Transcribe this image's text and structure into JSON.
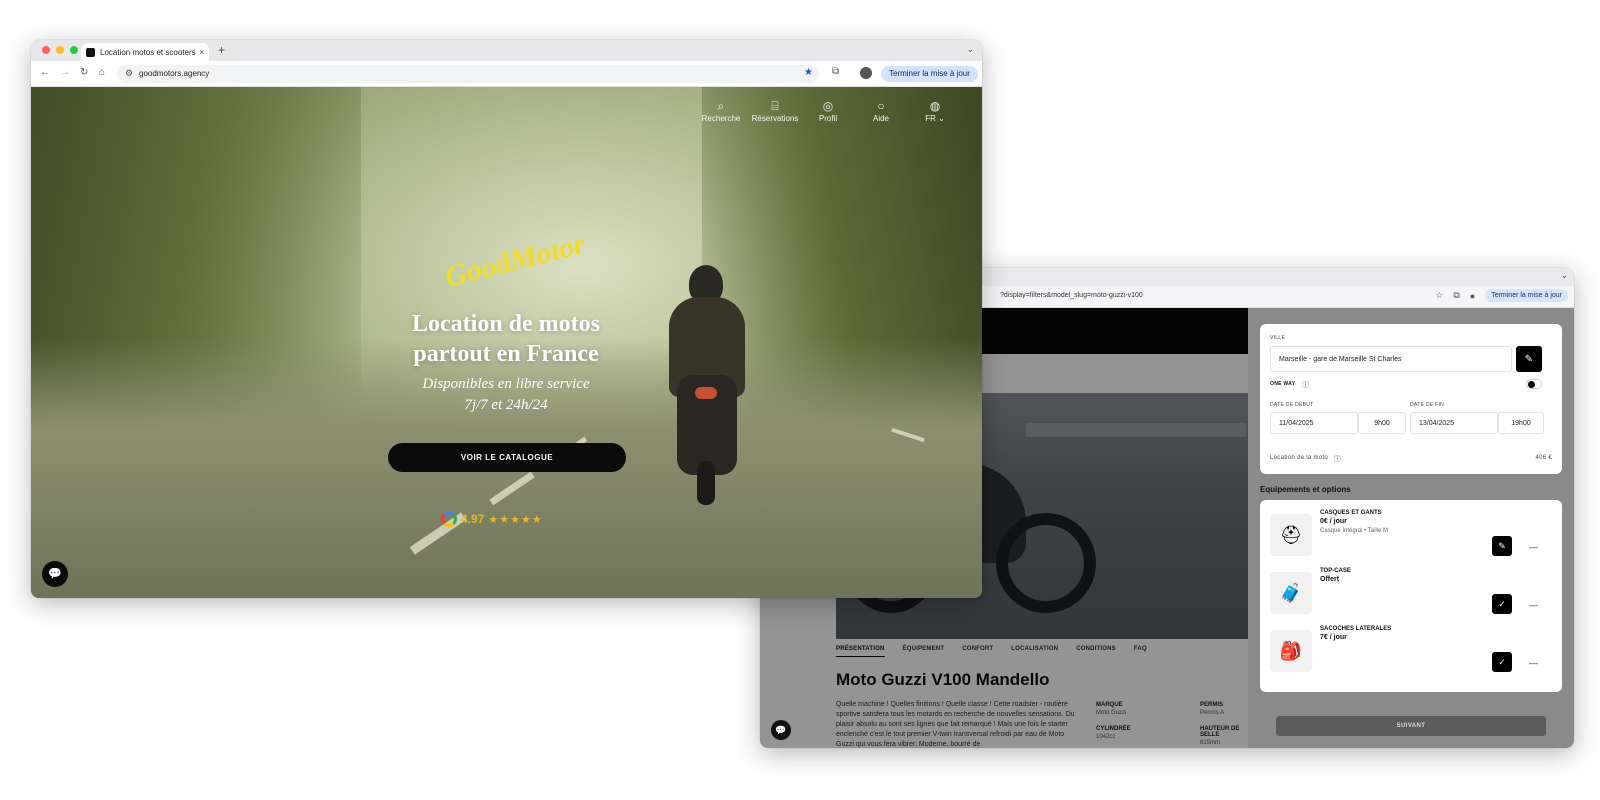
{
  "front": {
    "tab_title": "Location motos et scooters",
    "tab_close": "×",
    "new_tab": "+",
    "url": "goodmotors.agency",
    "update_btn": "Terminer la mise à jour",
    "nav": [
      {
        "label": "Recherche",
        "icon": "search-icon"
      },
      {
        "label": "Réservations",
        "icon": "bike-icon"
      },
      {
        "label": "Profil",
        "icon": "user-icon"
      },
      {
        "label": "Aide",
        "icon": "help-icon"
      },
      {
        "label": "FR",
        "icon": "globe-icon"
      }
    ],
    "logo_text": "GoodMotors",
    "hero_title_line1": "Location de motos",
    "hero_title_line2": "partout en France",
    "hero_sub_line1": "Disponibles en libre service",
    "hero_sub_line2": "7j/7 et 24h/24",
    "cta_label": "VOIR LE CATALOGUE",
    "rating_value": "4.97",
    "rating_stars": 5,
    "stars_glyphs": "★★★★★",
    "colors": {
      "cta": "#0b0b0b",
      "rating": "#e6b72a",
      "update": "#d3e3fd"
    }
  },
  "back": {
    "url": "?display=filters&model_slug=moto-guzzi-v100",
    "update_btn": "Terminer la mise à jour",
    "tabs": [
      {
        "label": "PRÉSENTATION",
        "active": true
      },
      {
        "label": "ÉQUIPEMENT",
        "active": false
      },
      {
        "label": "CONFORT",
        "active": false
      },
      {
        "label": "LOCALISATION",
        "active": false
      },
      {
        "label": "CONDITIONS",
        "active": false
      },
      {
        "label": "FAQ",
        "active": false
      }
    ],
    "moto_title": "Moto Guzzi V100 Mandello",
    "moto_desc": "Quelle machine ! Quelles finitions ! Quelle classe ! Cette roadster - routière sportive satisfera tous les motards en recherche de nouvelles sensations. Du plaisir absolu au sont ses lignes que fait remarqué ! Mais une fois le starter enclenché c'est le tout premier V-twin transversal refroidi par eau de Moto Guzzi qui vous fera vibrer. Moderne, bourré de",
    "specs": [
      {
        "k": "MARQUE",
        "v": "Moto Guzzi"
      },
      {
        "k": "PERMIS",
        "v": "Permis A"
      },
      {
        "k": "CYLINDRÉE",
        "v": "1042cc"
      },
      {
        "k": "HAUTEUR DE SELLE",
        "v": "815mm"
      }
    ],
    "booking": {
      "ville_label": "VILLE",
      "ville_value": "Marseille - gare de Marseille St Charles",
      "one_way_label": "ONE WAY",
      "date_debut_label": "DATE DE DÉBUT",
      "date_fin_label": "DATE DE FIN",
      "start_date": "11/04/2025",
      "start_time": "9h00",
      "end_date": "13/04/2025",
      "end_time": "19h00",
      "location_label": "Location de la moto",
      "location_price": "406 €",
      "options_title": "Equipements et options",
      "options": [
        {
          "name": "CASQUES ET GANTS",
          "price": "0€ / jour",
          "desc": "Casque Intégral • Taille M",
          "icon": "helmet-icon",
          "action": "edit-icon"
        },
        {
          "name": "TOP-CASE",
          "price": "Offert",
          "desc": "",
          "icon": "topcase-icon",
          "action": "check-icon"
        },
        {
          "name": "SACOCHES LATERALES",
          "price": "7€ / jour",
          "desc": "",
          "icon": "saddlebag-icon",
          "action": "check-icon"
        }
      ],
      "minus": "—",
      "next_label": "SUIVANT"
    }
  }
}
